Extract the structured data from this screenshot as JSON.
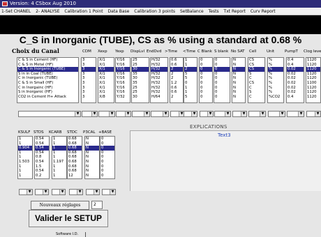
{
  "window": {
    "title": "Version: 4 CSbox Aug 2010"
  },
  "menu": [
    "1-Set CHANEL",
    "2- ANALYSE",
    "Calibration 1 Point",
    "Data Base",
    "Calibration 3 points",
    "SetBalance",
    "Tests",
    "Txt Report",
    "Curv Report"
  ],
  "heading": "C_S in Inorganic (TUBE), CS as % using a standard at 0.68 %",
  "channel_label": "Choix du Canal",
  "top_headers": [
    "CDM",
    "Xexp",
    "Yexp",
    "DispLvl",
    "EndDvd",
    ">Time",
    "<Time",
    "C Blank",
    "S blank",
    "No SAT",
    "Cell",
    "Unit",
    "PumpT",
    "Clog level"
  ],
  "channels": [
    "C & S in Cement (HF)",
    "C & S in Metal (HF)",
    "C & S in Inorganic (TUBE)",
    "S in in Coal (TUBE)",
    "C in Inorganic (TUBE)",
    "C & S in Small (HF)",
    "C in Inorgainc (HF)",
    "S in Inorganic (HF)",
    "CO2 in Cement H+ Attack"
  ],
  "selected_channel_index": 2,
  "top_columns": [
    [
      "3",
      "3",
      "3",
      "3",
      "3",
      "3",
      "3",
      "3",
      "3"
    ],
    [
      "X/1",
      "X/1",
      "X/1",
      "X/1",
      "X/1",
      "X/1",
      "X/1",
      "X/1",
      "X/8"
    ],
    [
      "Y/16",
      "Y/16",
      "Y/16",
      "Y/16",
      "Y/16",
      "Y/16",
      "Y/16",
      "Y/16",
      "Y/32"
    ],
    [
      "25",
      "25",
      "30",
      "35",
      "30",
      "35",
      "25",
      "25",
      "30"
    ],
    [
      "H/32",
      "H/32",
      "H/32",
      "H/32",
      "H/32",
      "H/32",
      "H/32",
      "H/32",
      "H/64"
    ],
    [
      "0.6",
      "0.6",
      "2",
      "2",
      "2",
      "1.2",
      "0.6",
      "0.6",
      "2"
    ],
    [
      "1",
      "1",
      "2",
      "5",
      "5",
      "0",
      "1",
      "1",
      "5"
    ],
    [
      "0",
      "0",
      "0",
      "0",
      "0",
      "0",
      "0",
      "0",
      "0"
    ],
    [
      "0",
      "0",
      "0",
      "0",
      "0",
      "0",
      "0",
      "0",
      "0"
    ],
    [
      "N",
      "N",
      "N",
      "N",
      "N",
      "N",
      "N",
      "N",
      "N"
    ],
    [
      "CS",
      "CS",
      "CS",
      "S",
      "C",
      "CS",
      "C",
      "S",
      "C"
    ],
    [
      "%",
      "%",
      "%",
      "%",
      "%",
      "%",
      "%",
      "%",
      "%CO2"
    ],
    [
      "0.4",
      "0.4",
      "0.02",
      "0.02",
      "0.02",
      "0.02",
      "0.02",
      "0.02",
      "0.4"
    ],
    [
      "1120",
      "1120",
      "1120",
      "1120",
      "1120",
      "1100",
      "1120",
      "1120",
      "1120"
    ]
  ],
  "bottom_headers": [
    "KSULF",
    "STDS",
    "KCARB",
    "STDC",
    "P3CAL",
    "+BASE"
  ],
  "bottom_columns": [
    [
      "1",
      "1",
      "0.904",
      "1",
      "1",
      "1.503",
      "1",
      "1",
      "1"
    ],
    [
      "0.54",
      "0.54",
      "0.54",
      "0.54",
      "0.8",
      "0.54",
      "1.5",
      "0.54",
      "0.2"
    ],
    [
      "1",
      "1",
      "1",
      "1",
      "1",
      "1.197",
      "1",
      "1",
      "1"
    ],
    [
      "0.68",
      "0.68",
      "0.68",
      "0.68",
      "0.68",
      "0.68",
      "0.68",
      "0.68",
      "12"
    ],
    [
      "N",
      "N",
      "N",
      "N",
      "N",
      "N",
      "N",
      "N",
      "N"
    ],
    [
      "0",
      "0",
      "0",
      "0",
      "0",
      "0",
      "0",
      "0",
      "0"
    ]
  ],
  "explications_label": "EXPLICATIONS",
  "explain_text": "Text3",
  "reset_button": "Nouveaux réglages",
  "reset_value": "2",
  "validate_button": "Valider le SETUP",
  "software_label": "Software I.D.",
  "colors": {
    "titlebar": "#2e2c78",
    "selection": "#2a2a8c",
    "explain_text": "#2244bb"
  }
}
